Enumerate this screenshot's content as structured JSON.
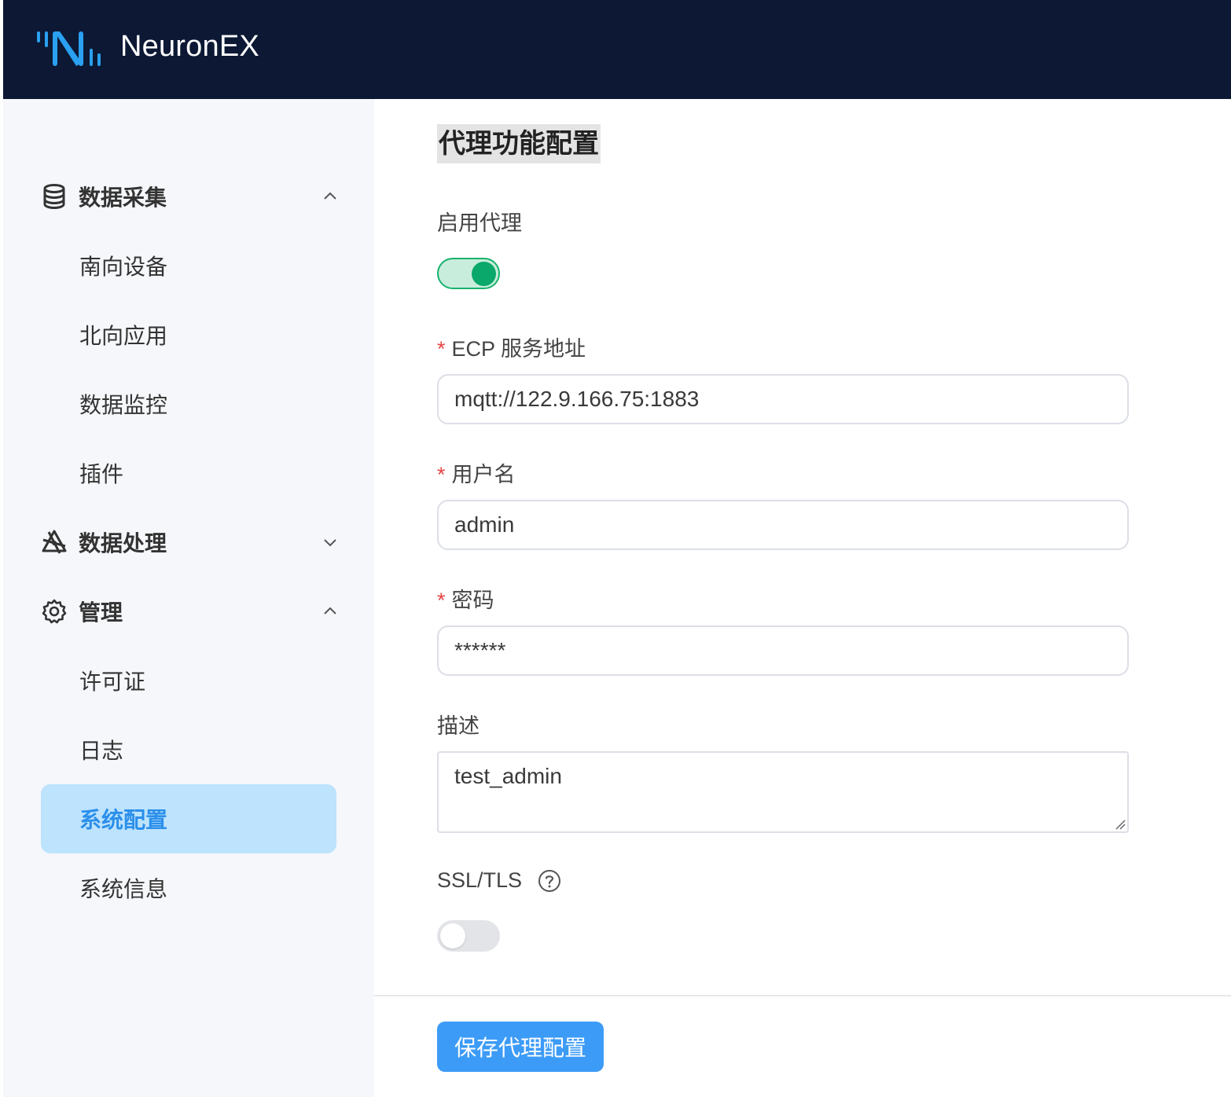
{
  "app": {
    "name": "NeuronEX"
  },
  "sidebar": {
    "groups": [
      {
        "label": "数据采集",
        "icon": "database-icon",
        "expanded": true,
        "items": [
          "南向设备",
          "北向应用",
          "数据监控",
          "插件"
        ]
      },
      {
        "label": "数据处理",
        "icon": "data-processing-icon",
        "expanded": false,
        "items": []
      },
      {
        "label": "管理",
        "icon": "gear-icon",
        "expanded": true,
        "items": [
          "许可证",
          "日志",
          "系统配置",
          "系统信息"
        ]
      }
    ],
    "active_item": "系统配置"
  },
  "form": {
    "title": "代理功能配置",
    "enable_proxy": {
      "label": "启用代理",
      "enabled": true
    },
    "ecp_address": {
      "label": "ECP 服务地址",
      "required_mark": "*",
      "value": "mqtt://122.9.166.75:1883"
    },
    "username": {
      "label": "用户名",
      "required_mark": "*",
      "value": "admin"
    },
    "password": {
      "label": "密码",
      "required_mark": "*",
      "value": "******"
    },
    "description": {
      "label": "描述",
      "value": "test_admin"
    },
    "ssl_tls": {
      "label": "SSL/TLS",
      "enabled": false,
      "help_icon": "question-circle-icon"
    },
    "save_button": "保存代理配置"
  },
  "colors": {
    "header_bg": "#0c1834",
    "accent": "#3c9bf7",
    "switch_on": "#0aa86a",
    "active_item_bg": "#bde3fd",
    "active_item_text": "#2b8fea",
    "required": "#e64545"
  }
}
